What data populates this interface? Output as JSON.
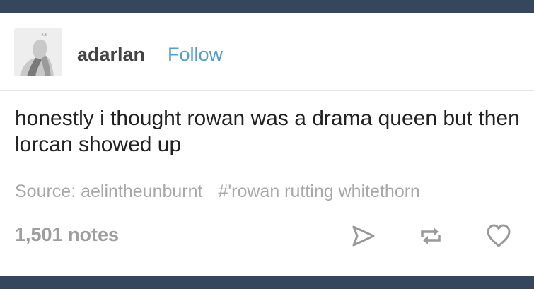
{
  "post": {
    "username": "adarlan",
    "follow_label": "Follow",
    "text": "honestly i thought rowan was a drama queen but then lorcan showed up",
    "source_label": "Source: aelintheunburnt",
    "tag": "#'rowan rutting whitethorn",
    "notes": "1,501 notes"
  },
  "icons": {
    "share": "share-icon",
    "reblog": "reblog-icon",
    "like": "heart-icon"
  },
  "colors": {
    "background": "#36465d",
    "card": "#ffffff",
    "follow": "#529ecc",
    "muted": "#a8a8a8"
  }
}
